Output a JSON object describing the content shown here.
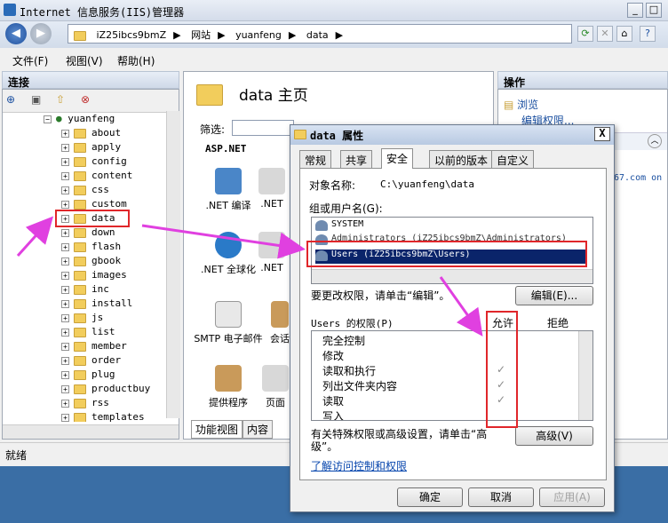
{
  "window": {
    "title": "Internet 信息服务(IIS)管理器",
    "breadcrumb": [
      "iZ25ibcs9bmZ",
      "网站",
      "yuanfeng",
      "data"
    ]
  },
  "menu": [
    "文件(F)",
    "视图(V)",
    "帮助(H)"
  ],
  "connections": {
    "header": "连接",
    "site": "yuanfeng",
    "folders": [
      "about",
      "apply",
      "config",
      "content",
      "css",
      "custom",
      "data",
      "down",
      "flash",
      "gbook",
      "images",
      "inc",
      "install",
      "js",
      "list",
      "member",
      "order",
      "plug",
      "productbuy",
      "rss",
      "templates"
    ],
    "selected": "data"
  },
  "center": {
    "title": "data 主页",
    "filter_label": "筛选:",
    "group": "ASP.NET",
    "features": [
      ".NET 编译",
      ".NET",
      ".NET 全球化",
      ".NET",
      "SMTP 电子邮件",
      "会话",
      "提供程序",
      "页面"
    ],
    "tabs": [
      "功能视图",
      "内容"
    ]
  },
  "actions": {
    "header": "操作",
    "items": [
      "浏览",
      "编辑权限..."
    ],
    "fragment": "67.com on"
  },
  "status": "就绪",
  "dialog": {
    "title": "data 属性",
    "close": "X",
    "tabs": [
      "常规",
      "共享",
      "安全",
      "以前的版本",
      "自定义"
    ],
    "active_tab": "安全",
    "object_label": "对象名称:",
    "object_value": "C:\\yuanfeng\\data",
    "groups_label": "组或用户名(G):",
    "users": [
      "SYSTEM",
      "Administrators (iZ25ibcs9bmZ\\Administrators)",
      "Users (iZ25ibcs9bmZ\\Users)"
    ],
    "selected_user": "Users (iZ25ibcs9bmZ\\Users)",
    "change_hint": "要更改权限，请单击“编辑”。",
    "edit_button": "编辑(E)...",
    "perm_label": "Users 的权限(P)",
    "allow": "允许",
    "deny": "拒绝",
    "permissions": [
      {
        "name": "完全控制",
        "allow": false
      },
      {
        "name": "修改",
        "allow": false
      },
      {
        "name": "读取和执行",
        "allow": true
      },
      {
        "name": "列出文件夹内容",
        "allow": true
      },
      {
        "name": "读取",
        "allow": true
      },
      {
        "name": "写入",
        "allow": false
      }
    ],
    "check_glyph": "✓",
    "advanced_hint_1": "有关特殊权限或高级设置，请单击“高",
    "advanced_hint_2": "级”。",
    "advanced_button": "高级(V)",
    "link": "了解访问控制和权限",
    "ok": "确定",
    "cancel": "取消",
    "apply": "应用(A)"
  },
  "colors": {
    "annotation": "#e0262a",
    "arrow": "#e040e0",
    "selection": "#0a246a"
  }
}
